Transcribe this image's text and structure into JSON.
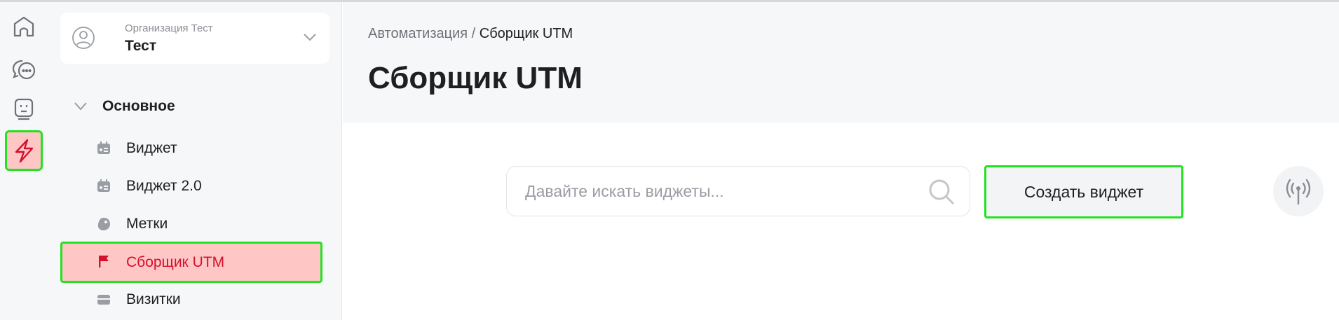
{
  "rail": {
    "items": [
      {
        "icon": "home-icon"
      },
      {
        "icon": "chat-icon"
      },
      {
        "icon": "bot-icon"
      },
      {
        "icon": "lightning-icon",
        "active": true
      }
    ]
  },
  "org": {
    "subtitle": "Организация Тест",
    "name": "Тест",
    "avatar_icon": "user-circle-icon",
    "chevron_icon": "chevron-down-icon"
  },
  "sidebar": {
    "section_label": "Основное",
    "items": [
      {
        "label": "Виджет",
        "icon": "widget-card-icon"
      },
      {
        "label": "Виджет 2.0",
        "icon": "widget-card-icon"
      },
      {
        "label": "Метки",
        "icon": "tag-icon"
      },
      {
        "label": "Сборщик UTM",
        "icon": "flag-icon",
        "active": true
      },
      {
        "label": "Визитки",
        "icon": "card-icon"
      }
    ]
  },
  "header": {
    "breadcrumb_parent": "Автоматизация",
    "breadcrumb_separator": " / ",
    "breadcrumb_current": "Сборщик UTM",
    "title": "Сборщик UTM"
  },
  "search": {
    "placeholder": "Давайте искать виджеты...",
    "value": ""
  },
  "actions": {
    "create_label": "Создать виджет",
    "broadcast_icon": "broadcast-icon"
  },
  "colors": {
    "accent": "#d3112a",
    "active_bg": "#ffc6c6",
    "highlight_border": "#22e222",
    "sidebar_bg": "#f6f7f9"
  }
}
